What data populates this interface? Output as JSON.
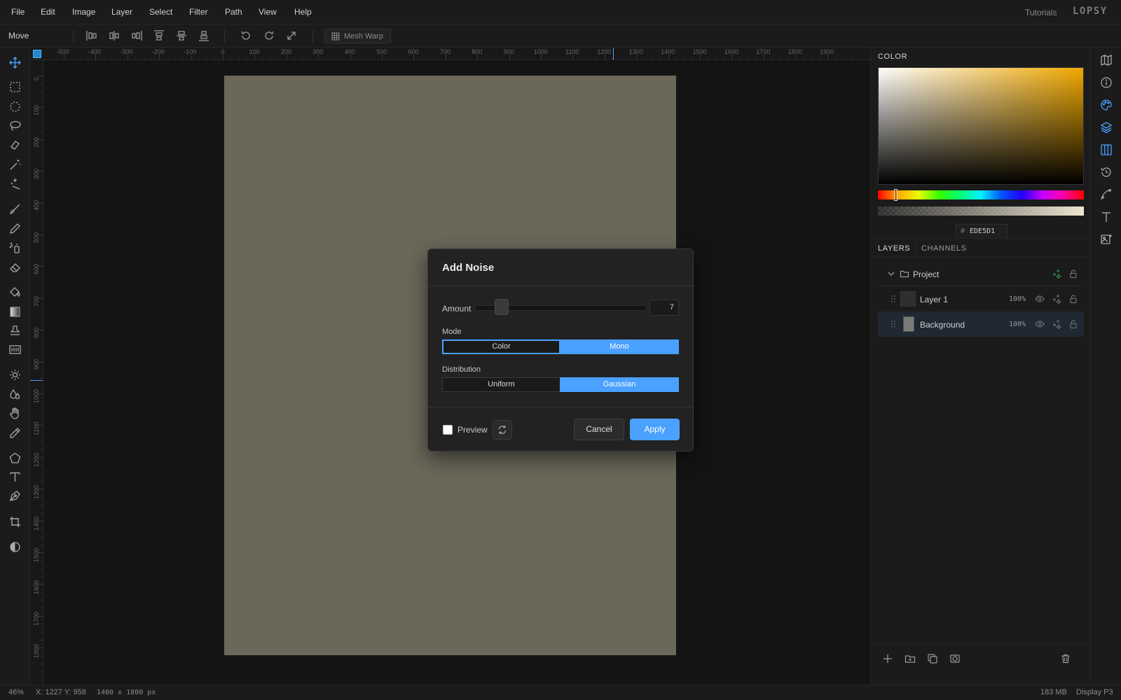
{
  "menu": {
    "items": [
      "File",
      "Edit",
      "Image",
      "Layer",
      "Select",
      "Filter",
      "Path",
      "View",
      "Help"
    ],
    "tutorials": "Tutorials",
    "logo": "LOPSY"
  },
  "options": {
    "tool_name": "Move",
    "mesh_warp": "Mesh Warp"
  },
  "rulers": {
    "top": [
      "-500",
      "-400",
      "-300",
      "-200",
      "-100",
      "0",
      "100",
      "200",
      "300",
      "400",
      "500",
      "600",
      "700",
      "800",
      "900",
      "1000",
      "1100",
      "1200",
      "1300",
      "1400",
      "1500",
      "1600",
      "1700",
      "1800",
      "1900"
    ],
    "left": [
      "0",
      "100",
      "200",
      "300",
      "400",
      "500",
      "600",
      "700",
      "800",
      "900",
      "1000",
      "1100",
      "1200",
      "1300",
      "1400",
      "1500",
      "1600",
      "1700",
      "1800"
    ]
  },
  "canvas": {
    "fill": "#6b685a",
    "accent": "#4aa1ff"
  },
  "status": {
    "zoom": "46%",
    "coords": "X: 1227  Y: 958",
    "size": "1400 x 1800 px",
    "memory": "183 MB",
    "profile": "Display P3"
  },
  "color_panel": {
    "tab": "COLOR",
    "hex_prefix": "#",
    "hex": "EDE5D1"
  },
  "layers_panel": {
    "tabs": [
      "LAYERS",
      "CHANNELS"
    ],
    "group": "Project",
    "layers": [
      {
        "name": "Layer 1",
        "opacity": "100%"
      },
      {
        "name": "Background",
        "opacity": "100%"
      }
    ]
  },
  "dialog": {
    "title": "Add Noise",
    "amount_label": "Amount",
    "amount_value": "7",
    "mode_label": "Mode",
    "mode_options": [
      "Color",
      "Mono"
    ],
    "mode_selected": "Mono",
    "distribution_label": "Distribution",
    "distribution_options": [
      "Uniform",
      "Gaussian"
    ],
    "distribution_selected": "Gaussian",
    "preview_label": "Preview",
    "preview_checked": false,
    "cancel": "Cancel",
    "apply": "Apply"
  }
}
